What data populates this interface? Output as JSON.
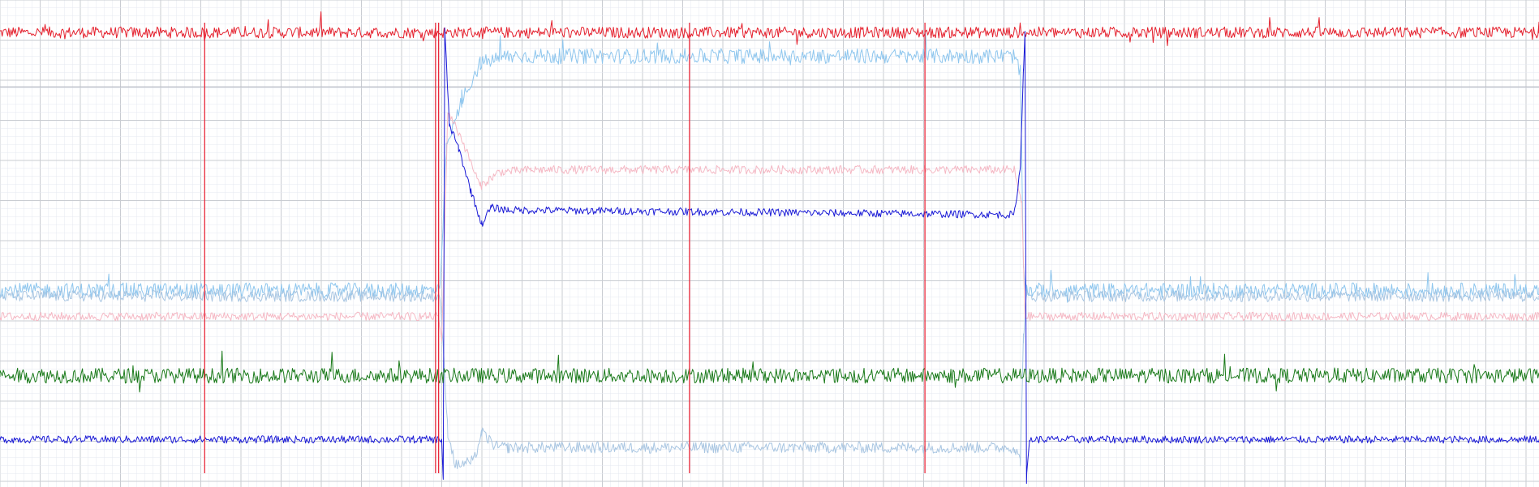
{
  "chart_data": {
    "type": "line",
    "title": "",
    "xlabel": "",
    "ylabel": "",
    "grid": true,
    "legend": "none",
    "xlim": [
      0,
      1000
    ],
    "ylim": [
      0,
      100
    ],
    "reference_line_y": 83,
    "colors": {
      "background": "#ffffff",
      "grid_minor": "#e6e9f0",
      "grid_major": "#c9ccd2",
      "reference": "#b8bcc4"
    },
    "event_markers": {
      "color": "#e8283a",
      "x": [
        133,
        283,
        285,
        448,
        601
      ]
    },
    "series": [
      {
        "color": "#e5202d",
        "noise": 1.2,
        "spikes": true,
        "points": [
          [
            0,
            94.5
          ],
          [
            1000,
            94.5
          ]
        ]
      },
      {
        "color": "#8ec6ee",
        "noise": 1.6,
        "spikes": true,
        "points": [
          [
            0,
            40
          ],
          [
            286,
            40
          ],
          [
            290,
            70
          ],
          [
            300,
            80
          ],
          [
            312,
            88
          ],
          [
            330,
            89.5
          ],
          [
            659,
            89.5
          ],
          [
            663,
            86
          ],
          [
            665,
            45
          ],
          [
            667,
            40
          ],
          [
            1000,
            40
          ]
        ]
      },
      {
        "color": "#a9c6e2",
        "noise": 1.2,
        "spikes": false,
        "points": [
          [
            0,
            38.8
          ],
          [
            286,
            38.8
          ],
          [
            291,
            10
          ],
          [
            296,
            3
          ],
          [
            308,
            4
          ],
          [
            313,
            10
          ],
          [
            322,
            7
          ],
          [
            330,
            6.8
          ],
          [
            659,
            6.8
          ],
          [
            663,
            4
          ],
          [
            665,
            30
          ],
          [
            667,
            38.8
          ],
          [
            1000,
            38.8
          ]
        ]
      },
      {
        "color": "#f5b8c4",
        "noise": 0.9,
        "spikes": false,
        "points": [
          [
            0,
            34.5
          ],
          [
            285,
            34.5
          ],
          [
            287,
            29
          ],
          [
            291,
            78
          ],
          [
            300,
            72
          ],
          [
            312,
            62
          ],
          [
            324,
            65
          ],
          [
            345,
            65.5
          ],
          [
            659,
            65.5
          ],
          [
            664,
            58
          ],
          [
            666,
            34.5
          ],
          [
            1000,
            34.5
          ]
        ]
      },
      {
        "color": "#1a1ad6",
        "noise": 0.8,
        "spikes": false,
        "points": [
          [
            0,
            8.5
          ],
          [
            287,
            8.5
          ],
          [
            288,
            0
          ],
          [
            289,
            95
          ],
          [
            292,
            75
          ],
          [
            298,
            70
          ],
          [
            306,
            61
          ],
          [
            313,
            54
          ],
          [
            319,
            57.5
          ],
          [
            330,
            57
          ],
          [
            659,
            56
          ],
          [
            663,
            66
          ],
          [
            665,
            87
          ],
          [
            666,
            95
          ],
          [
            667,
            0
          ],
          [
            669,
            8.5
          ],
          [
            1000,
            8.5
          ]
        ]
      },
      {
        "color": "#1a7a1a",
        "noise": 1.6,
        "spikes": true,
        "points": [
          [
            0,
            22
          ],
          [
            1000,
            22
          ]
        ]
      }
    ]
  }
}
